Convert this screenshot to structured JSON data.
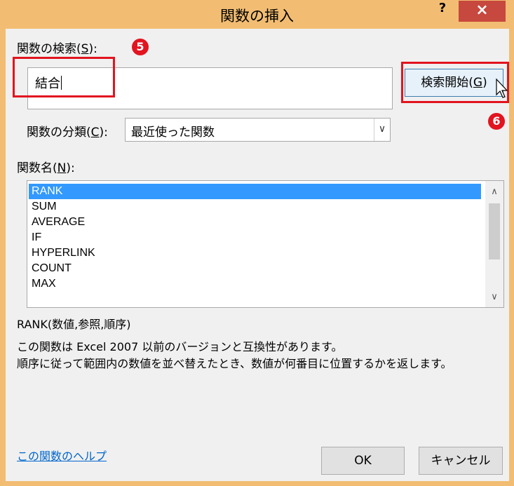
{
  "window": {
    "title": "関数の挿入",
    "help_label": "?",
    "close_label": "×"
  },
  "search": {
    "label_prefix": "関数の検索(",
    "label_key": "S",
    "label_suffix": "):",
    "value": "結合",
    "go_button_prefix": "検索開始(",
    "go_button_key": "G",
    "go_button_suffix": ")"
  },
  "category": {
    "label_prefix": "関数の分類(",
    "label_key": "C",
    "label_suffix": "):",
    "selected": "最近使った関数"
  },
  "function_list": {
    "label_prefix": "関数名(",
    "label_key": "N",
    "label_suffix": "):",
    "items": [
      "RANK",
      "SUM",
      "AVERAGE",
      "IF",
      "HYPERLINK",
      "COUNT",
      "MAX"
    ],
    "selected_index": 0
  },
  "description": {
    "syntax": "RANK(数値,参照,順序)",
    "line1": "この関数は Excel 2007 以前のバージョンと互換性があります。",
    "line2": "順序に従って範囲内の数値を並べ替えたとき、数値が何番目に位置するかを返します。"
  },
  "annotations": {
    "badge_5": "5",
    "badge_6": "6",
    "color": "#e2141f"
  },
  "footer": {
    "help_link": "この関数のヘルプ",
    "ok_label": "OK",
    "cancel_label": "キャンセル"
  }
}
